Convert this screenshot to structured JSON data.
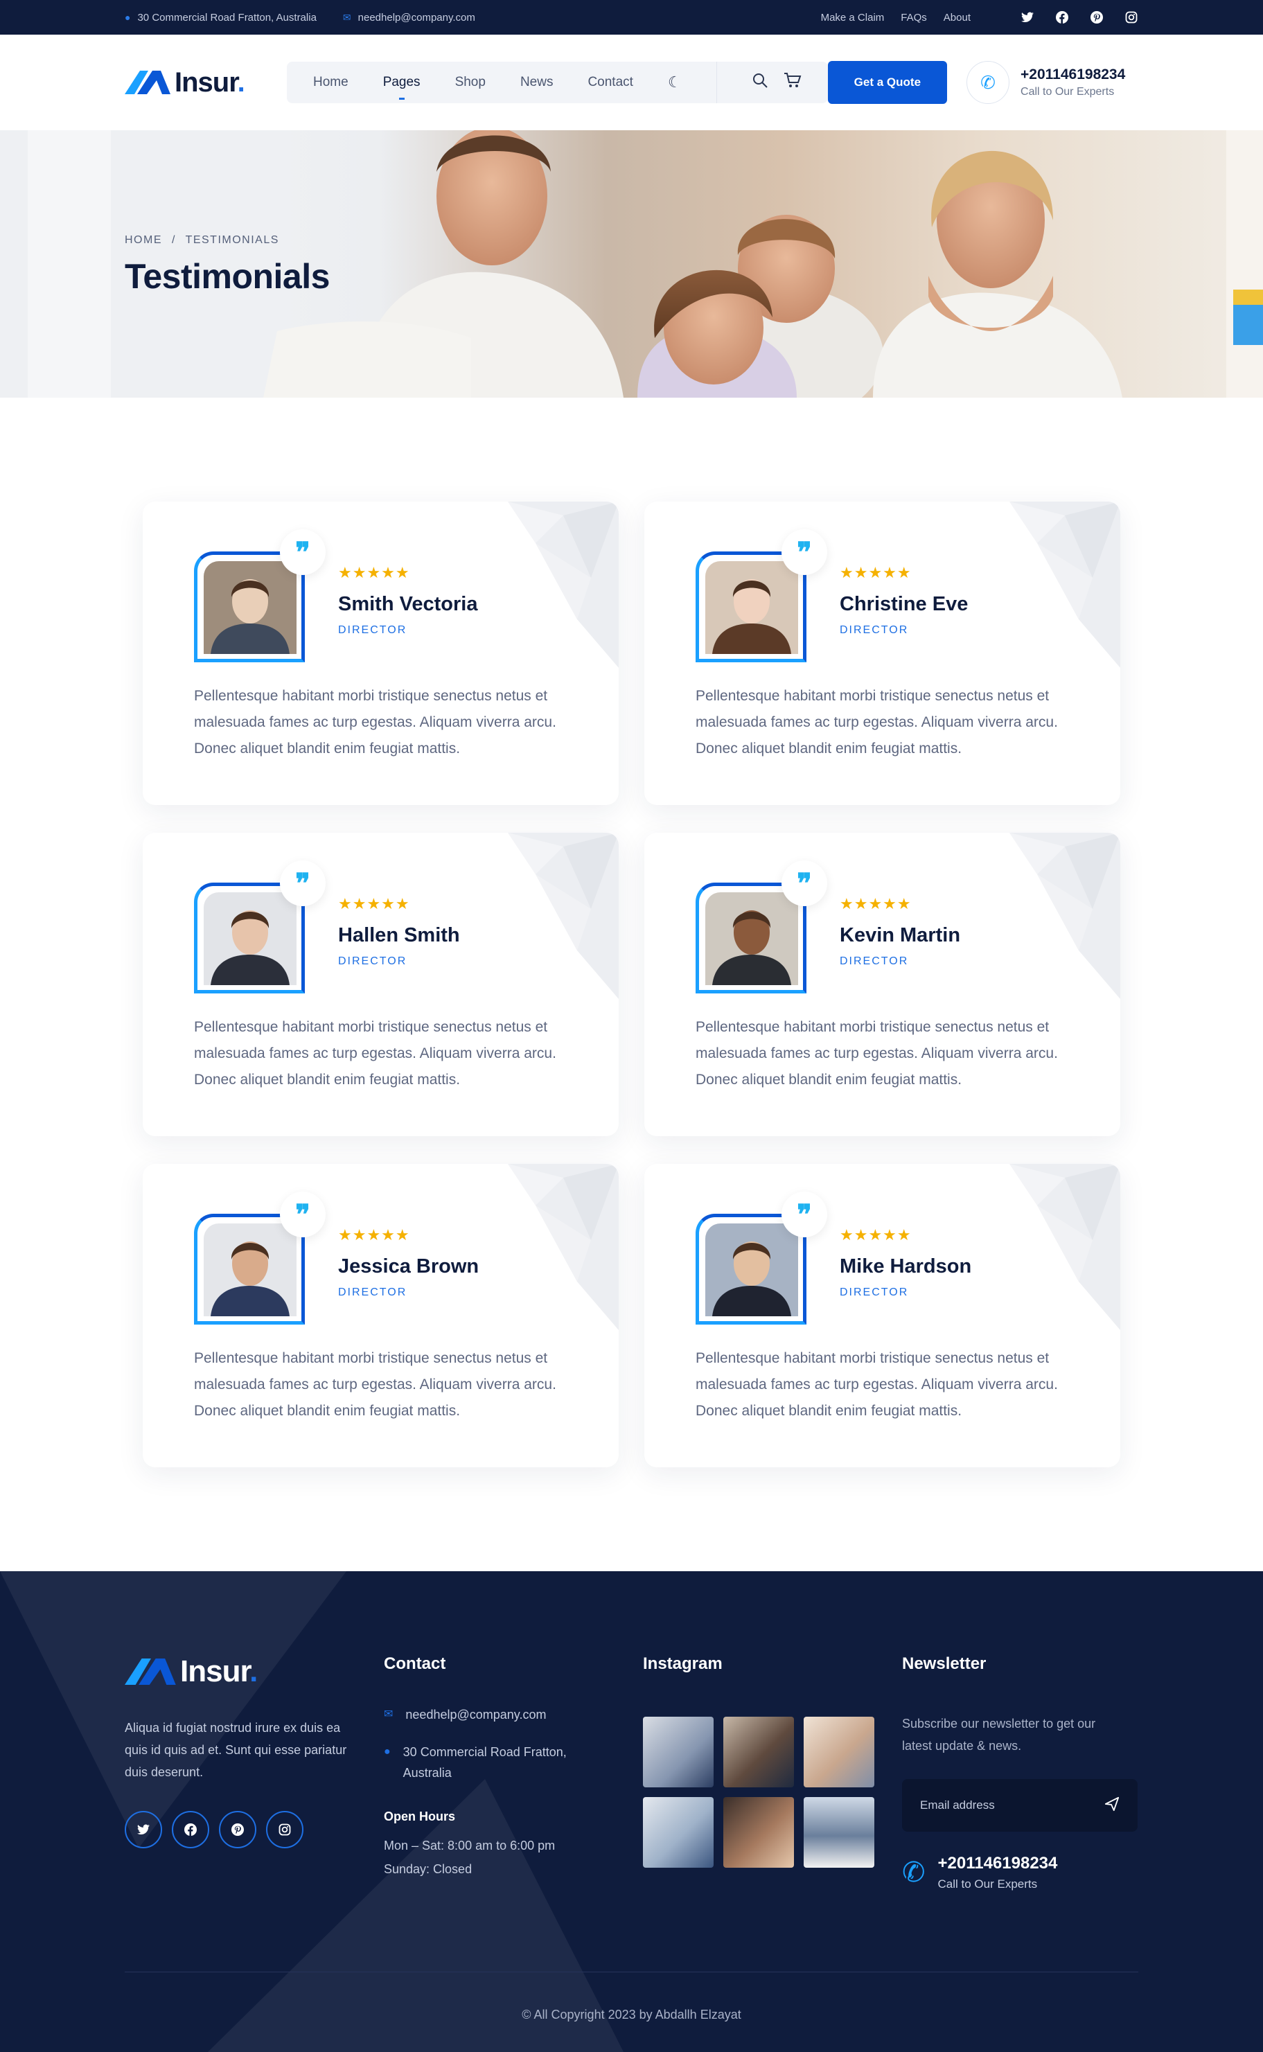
{
  "topbar": {
    "address": "30 Commercial Road Fratton, Australia",
    "email": "needhelp@company.com",
    "links": [
      "Make a Claim",
      "FAQs",
      "About"
    ],
    "socials": [
      "twitter-icon",
      "facebook-icon",
      "pinterest-icon",
      "instagram-icon"
    ]
  },
  "header": {
    "logo": "Insur",
    "logo_dot": ".",
    "nav": [
      "Home",
      "Pages",
      "Shop",
      "News",
      "Contact"
    ],
    "active_nav": "Pages",
    "quote_button": "Get a Quote",
    "phone": "+201146198234",
    "phone_sub": "Call to Our Experts"
  },
  "hero": {
    "breadcrumb_home": "HOME",
    "breadcrumb_sep": "/",
    "breadcrumb_current": "TESTIMONIALS",
    "title": "Testimonials"
  },
  "testimonials": [
    {
      "name": "Smith Vectoria",
      "role": "DIRECTOR",
      "stars": "★★★★★",
      "text": "Pellentesque habitant morbi tristique senectus netus et malesuada fames ac turp egestas. Aliquam viverra arcu. Donec aliquet blandit enim feugiat mattis."
    },
    {
      "name": "Christine Eve",
      "role": "DIRECTOR",
      "stars": "★★★★★",
      "text": "Pellentesque habitant morbi tristique senectus netus et malesuada fames ac turp egestas. Aliquam viverra arcu. Donec aliquet blandit enim feugiat mattis."
    },
    {
      "name": "Hallen Smith",
      "role": "DIRECTOR",
      "stars": "★★★★★",
      "text": "Pellentesque habitant morbi tristique senectus netus et malesuada fames ac turp egestas. Aliquam viverra arcu. Donec aliquet blandit enim feugiat mattis."
    },
    {
      "name": "Kevin Martin",
      "role": "DIRECTOR",
      "stars": "★★★★★",
      "text": "Pellentesque habitant morbi tristique senectus netus et malesuada fames ac turp egestas. Aliquam viverra arcu. Donec aliquet blandit enim feugiat mattis."
    },
    {
      "name": "Jessica Brown",
      "role": "DIRECTOR",
      "stars": "★★★★★",
      "text": "Pellentesque habitant morbi tristique senectus netus et malesuada fames ac turp egestas. Aliquam viverra arcu. Donec aliquet blandit enim feugiat mattis."
    },
    {
      "name": "Mike Hardson",
      "role": "DIRECTOR",
      "stars": "★★★★★",
      "text": "Pellentesque habitant morbi tristique senectus netus et malesuada fames ac turp egestas. Aliquam viverra arcu. Donec aliquet blandit enim feugiat mattis."
    }
  ],
  "footer": {
    "logo": "Insur",
    "logo_dot": ".",
    "about": "Aliqua id fugiat nostrud irure ex duis ea quis id quis ad et. Sunt qui esse pariatur duis deserunt.",
    "contact_heading": "Contact",
    "email": "needhelp@company.com",
    "address": "30 Commercial Road Fratton, Australia",
    "hours_heading": "Open Hours",
    "hours_line1": "Mon – Sat: 8:00 am to 6:00 pm",
    "hours_line2": "Sunday: Closed",
    "instagram_heading": "Instagram",
    "newsletter_heading": "Newsletter",
    "newsletter_text": "Subscribe our newsletter to get our latest update & news.",
    "email_placeholder": "Email address",
    "phone": "+201146198234",
    "phone_sub": "Call to Our Experts",
    "copyright": "© All Copyright 2023 by Abdallh Elzayat"
  },
  "colors": {
    "primary": "#0a57d6",
    "accent": "#1aa0ff",
    "dark": "#0f1c3d",
    "star": "#f5b100"
  }
}
